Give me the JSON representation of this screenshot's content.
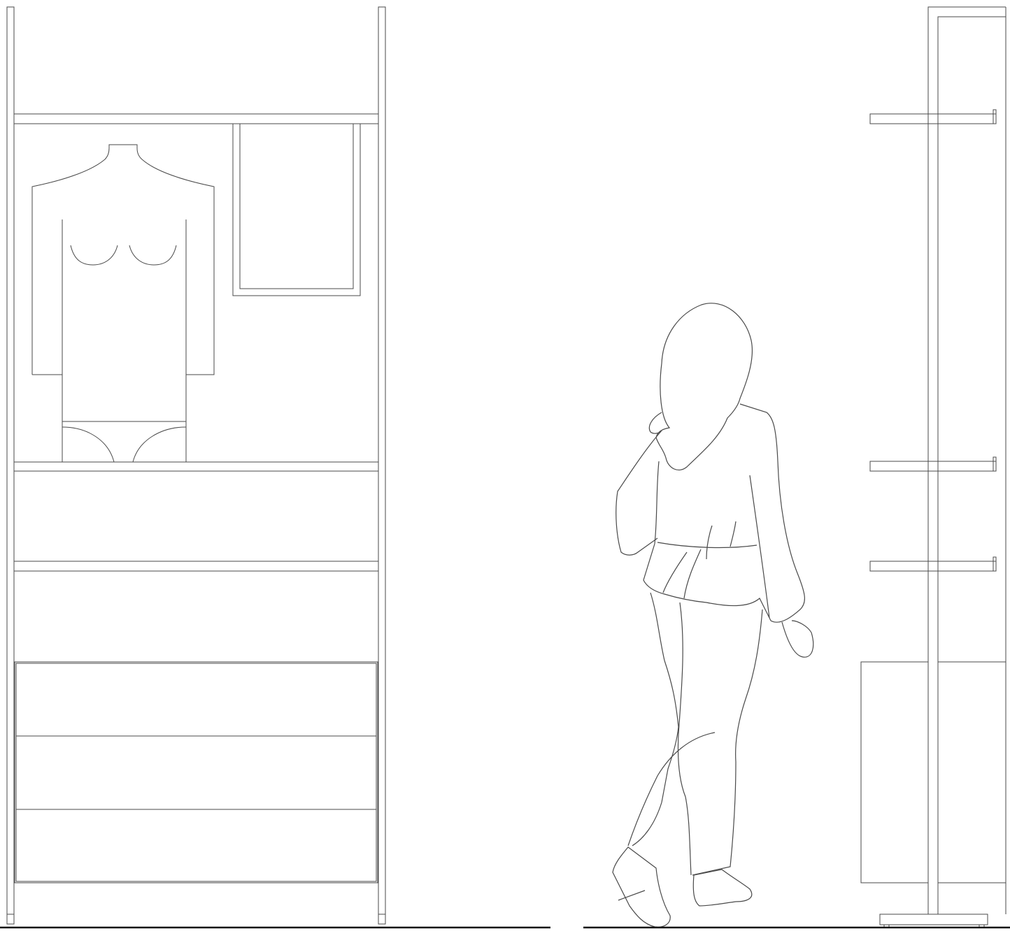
{
  "drawing": {
    "type": "interior-elevation-line-drawing",
    "text": [],
    "line_color": "#4a4a4a",
    "ground_color": "#111111",
    "background": "#ffffff"
  },
  "shelving_unit": {
    "fixed_shelves": 3,
    "drawers": 3,
    "display": [
      "torso-mannequin",
      "wall-frame"
    ]
  },
  "figure": {
    "pose": "walking",
    "facing": "left"
  },
  "display_rack": {
    "arms": 3,
    "lower_cabinet": true
  }
}
